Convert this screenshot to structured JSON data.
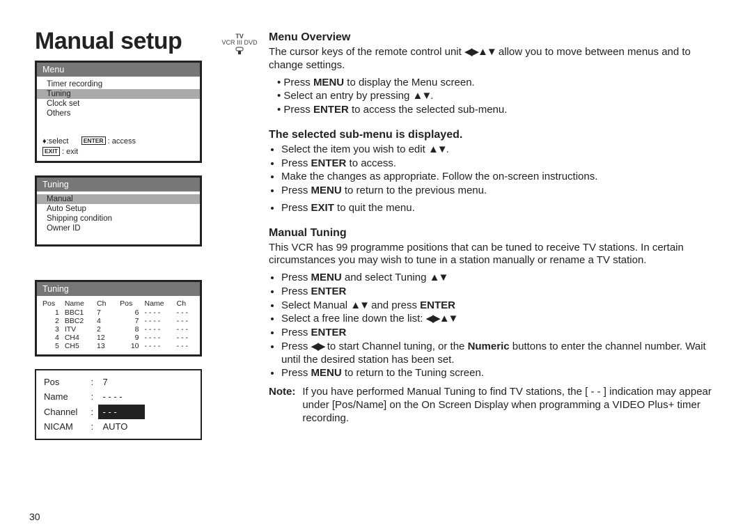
{
  "page_number": "30",
  "title": "Manual setup",
  "remote_icon": {
    "top": "TV",
    "bottom": "VCR ⅠⅠⅠ DVD"
  },
  "osd_menu": {
    "header": "Menu",
    "items": [
      "Timer recording",
      "Tuning",
      "Clock set",
      "Others"
    ],
    "highlight_index": 1,
    "footer_select": ":select",
    "footer_access": ": access",
    "footer_exit": ": exit",
    "key_enter": "ENTER",
    "key_exit": "EXIT"
  },
  "osd_tuning_menu": {
    "header": "Tuning",
    "items": [
      "Manual",
      "Auto Setup",
      "Shipping condition",
      "Owner ID"
    ],
    "highlight_index": 0
  },
  "osd_tuning_list": {
    "header": "Tuning",
    "cols": [
      "Pos",
      "Name",
      "Ch",
      "Pos",
      "Name",
      "Ch"
    ],
    "rows": [
      [
        "1",
        "BBC1",
        "7",
        "6",
        "- - - -",
        "- - -"
      ],
      [
        "2",
        "BBC2",
        "4",
        "7",
        "- - - -",
        "- - -"
      ],
      [
        "3",
        "ITV",
        "2",
        "8",
        "- - - -",
        "- - -"
      ],
      [
        "4",
        "CH4",
        "12",
        "9",
        "- - - -",
        "- - -"
      ],
      [
        "5",
        "CH5",
        "13",
        "10",
        "- - - -",
        "- - -"
      ]
    ]
  },
  "info_box": {
    "rows": [
      {
        "k": "Pos",
        "v": "7",
        "hl": false
      },
      {
        "k": "Name",
        "v": "- - - -",
        "hl": false
      },
      {
        "k": "Channel",
        "v": "- - -",
        "hl": true
      },
      {
        "k": "NICAM",
        "v": "AUTO",
        "hl": false
      }
    ]
  },
  "arrows": {
    "all": "◀▶▲▼",
    "ud": "▲▼",
    "lr": "◀▶"
  },
  "rhs": {
    "h1": "Menu Overview",
    "p1a": "The cursor keys of the remote control unit ",
    "p1b": " allow you to move between menus and to change settings.",
    "l1a_a": "Press ",
    "l1a_b": "MENU",
    "l1a_c": " to display the Menu screen.",
    "l1b_a": "Select an entry by pressing ",
    "l1b_b": ".",
    "l1c_a": "Press ",
    "l1c_b": "ENTER",
    "l1c_c": " to access the selected sub-menu.",
    "h2": "The selected sub-menu is displayed.",
    "l2a_a": "Select the item you wish to edit ",
    "l2a_b": ".",
    "l2b_a": "Press ",
    "l2b_b": "ENTER",
    "l2b_c": " to access.",
    "l2c": "Make the changes as appropriate. Follow the on-screen instructions.",
    "l2d_a": "Press ",
    "l2d_b": "MENU",
    "l2d_c": " to return to the previous menu.",
    "l2e_a": "Press ",
    "l2e_b": "EXIT",
    "l2e_c": " to quit the menu.",
    "h3": "Manual Tuning",
    "p3": "This VCR has 99 programme positions that can be tuned to receive TV stations. In certain circumstances you may wish to tune in a station manually or rename a TV station.",
    "l3a_a": "Press ",
    "l3a_b": "MENU",
    "l3a_c": " and select Tuning ",
    "l3b_a": "Press ",
    "l3b_b": "ENTER",
    "l3c_a": "Select Manual ",
    "l3c_b": " and press ",
    "l3c_c": "ENTER",
    "l3d_a": "Select a free line down the list: ",
    "l3e_a": "Press ",
    "l3e_b": "ENTER",
    "l3f_a": "Press ",
    "l3f_b": " to start Channel tuning, or the ",
    "l3f_c": "Numeric",
    "l3f_d": " buttons to enter the channel number. Wait until the desired station has been set.",
    "l3g_a": "Press ",
    "l3g_b": "MENU",
    "l3g_c": " to return to the Tuning screen.",
    "note_lbl": "Note:",
    "note": "If you have performed Manual Tuning to find TV stations, the [ - - ] indication may appear under [Pos/Name] on the On Screen Display when programming a VIDEO Plus+ timer recording."
  }
}
